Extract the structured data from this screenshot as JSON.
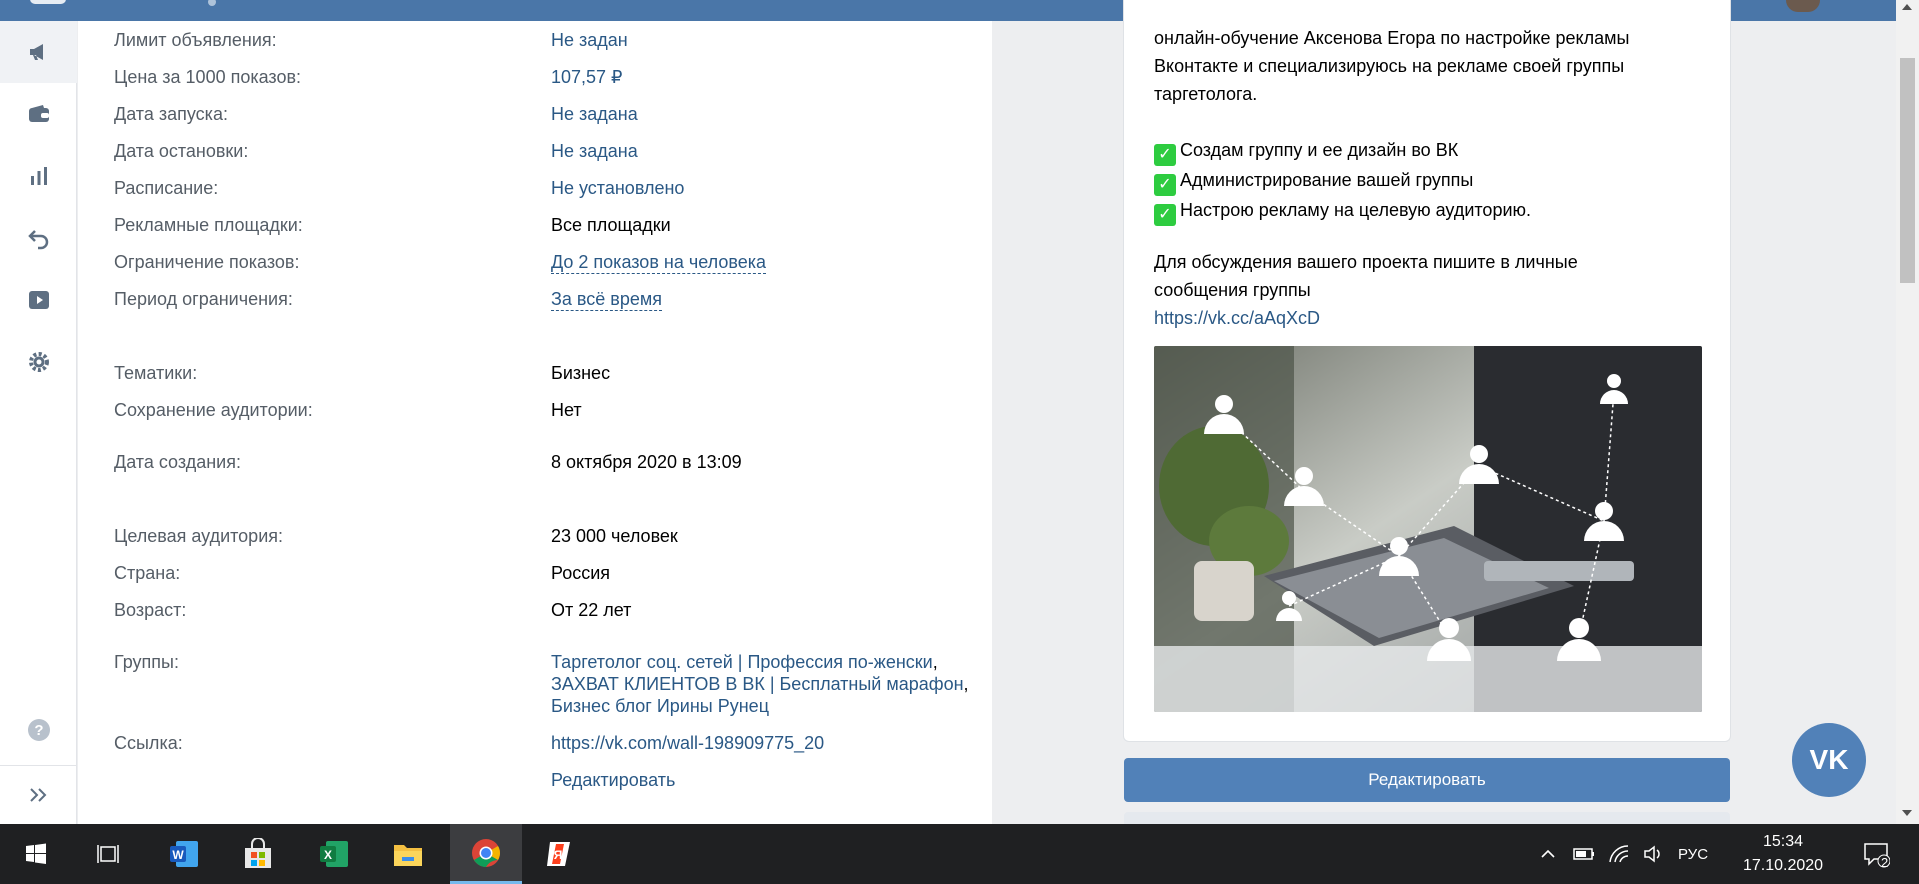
{
  "details": [
    {
      "label": "Лимит объявления:",
      "value": "Не задан",
      "style": "link"
    },
    {
      "label": "Цена за 1000 показов:",
      "value": "107,57 ₽",
      "style": "link"
    },
    {
      "label": "Дата запуска:",
      "value": "Не задана",
      "style": "link"
    },
    {
      "label": "Дата остановки:",
      "value": "Не задана",
      "style": "link"
    },
    {
      "label": "Расписание:",
      "value": "Не установлено",
      "style": "link"
    },
    {
      "label": "Рекламные площадки:",
      "value": "Все площадки",
      "style": "plain"
    },
    {
      "label": "Ограничение показов:",
      "value": "До 2 показов на человека",
      "style": "dashed"
    },
    {
      "label": "Период ограничения:",
      "value": "За всё время",
      "style": "dashed"
    },
    {
      "label": "Тематики:",
      "value": "Бизнес",
      "style": "plain"
    },
    {
      "label": "Сохранение аудитории:",
      "value": "Нет",
      "style": "plain"
    },
    {
      "label": "Дата создания:",
      "value": "8 октября 2020 в 13:09",
      "style": "plain"
    },
    {
      "label": "Целевая аудитория:",
      "value": "23 000 человек",
      "style": "plain"
    },
    {
      "label": "Страна:",
      "value": "Россия",
      "style": "plain"
    },
    {
      "label": "Возраст:",
      "value": "От 22 лет",
      "style": "plain"
    }
  ],
  "groups": {
    "label": "Группы:",
    "items": [
      "Таргетолог соц. сетей | Профессия по-женски",
      "ЗАХВАТ КЛИЕНТОВ В ВК | Бесплатный марафон",
      "Бизнес блог Ирины Рунец"
    ]
  },
  "link_row": {
    "label": "Ссылка:",
    "value": "https://vk.com/wall-198909775_20"
  },
  "edit_link": "Редактировать",
  "preview": {
    "intro": [
      "онлайн-обучение Аксенова Егора по настройке рекламы",
      "Вконтакте и специализируюсь на рекламе своей группы",
      "таргетолога."
    ],
    "checks": [
      "Создам группу и ее дизайн во ВК",
      "Администрирование вашей группы",
      "Настрою рекламу на целевую аудиторию."
    ],
    "contact": [
      "Для обсуждения вашего проекта пишите в личные",
      "сообщения группы"
    ],
    "url": "https://vk.cc/aAqXcD"
  },
  "edit_button": "Редактировать",
  "vk_logo_text": "VK",
  "taskbar": {
    "language": "РУС",
    "time": "15:34",
    "date": "17.10.2020",
    "notifications": "2"
  },
  "colors": {
    "accent": "#4a76a8",
    "button": "#5181b8",
    "link": "#2a5885"
  },
  "rail_icons": [
    "megaphone-icon",
    "wallet-icon",
    "stats-icon",
    "undo-icon",
    "video-icon",
    "gear-icon"
  ]
}
